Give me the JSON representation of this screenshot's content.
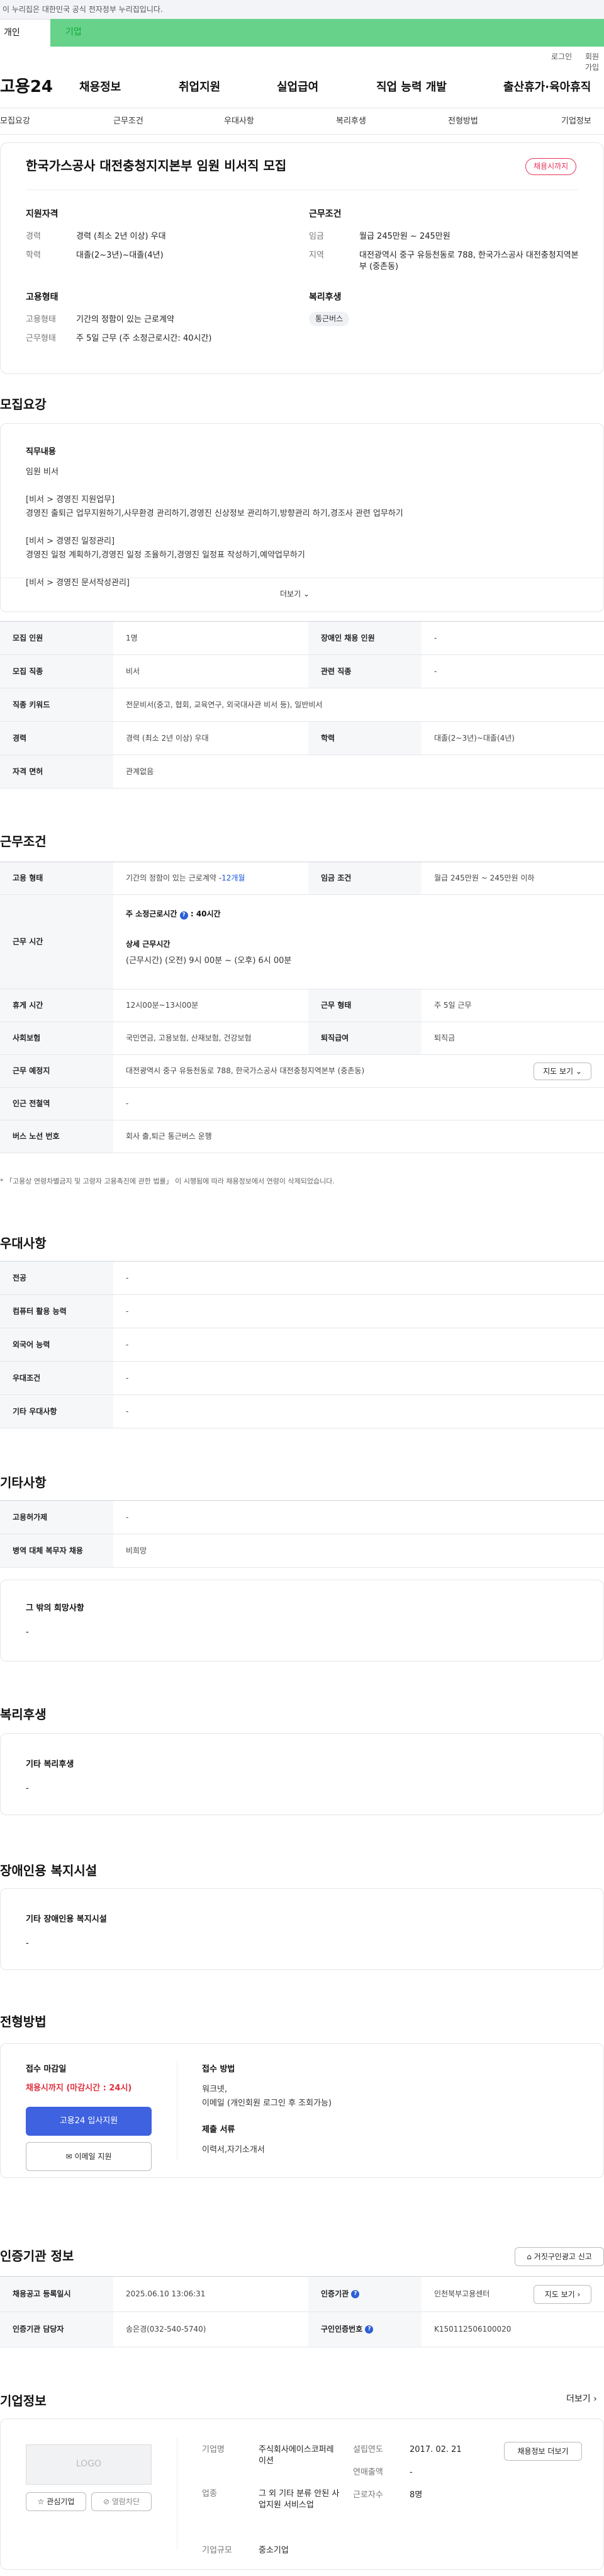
{
  "gov_banner": "이 누리집은 대한민국 공식 전자정부 누리집입니다.",
  "user_tabs": {
    "person": "개인",
    "company": "기업"
  },
  "util": {
    "login": "로그인",
    "join": "회원가입"
  },
  "gnb": {
    "logo": "고용24",
    "items": [
      "채용정보",
      "취업지원",
      "실업급여",
      "직업 능력 개발",
      "출산휴가·육아휴직"
    ]
  },
  "anchors": [
    "모집요강",
    "근무조건",
    "우대사항",
    "복리후생",
    "전형방법",
    "기업정보"
  ],
  "header": {
    "title": "한국가스공사 대전충청지지본부 임원 비서직 모집",
    "status": "채용시까지",
    "qual_title": "지원자격",
    "career_label": "경력",
    "career_value": "경력 (최소 2년 이상) 우대",
    "edu_label": "학력",
    "edu_value": "대졸(2~3년)~대졸(4년)",
    "cond_title": "근무조건",
    "wage_label": "임금",
    "wage_value": "월급 245만원 ~ 245만원",
    "region_label": "지역",
    "region_value": "대전광역시 중구 유등천동로 788, 한국가스공사 대전충청지역본부 (중촌동)",
    "emp_title": "고용형태",
    "emp_type_label": "고용형태",
    "emp_type_value": "기간의 정함이 있는 근로계약",
    "work_type_label": "근무형태",
    "work_type_value": "주 5일 근무 (주 소정근로시간: 40시간)",
    "welfare_title": "복리후생",
    "welfare_chip": "통근버스"
  },
  "recruit": {
    "title": "모집요강",
    "job_title": "직무내용",
    "lines": [
      "임원 비서",
      "",
      "[비서 > 경영진 지원업무]",
      "경영진 출퇴근 업무지원하기,사무환경 관리하기,경영진 신상정보 관리하기,방향관리 하기,경조사 관련 업무하기",
      "",
      "[비서 > 경영진 일정관리]",
      "경영진 일정 계획하기,경영진 일정 조율하기,경영진 일정표 작성하기,예약업무하기",
      "",
      "[비서 > 경영진 문서작성관리]"
    ],
    "more": "더보기",
    "table": [
      {
        "l1": "모집 인원",
        "v1": "1명",
        "l2": "장애인 채용 인원",
        "v2": "-"
      },
      {
        "l1": "모집 직종",
        "v1": "비서",
        "l2": "관련 직종",
        "v2": "-"
      },
      {
        "l1": "직종 키워드",
        "v1": "전문비서(중고, 협회, 교육연구, 외국대사관 비서 등), 일반비서",
        "l2": "",
        "v2": ""
      },
      {
        "l1": "경력",
        "v1": "경력 (최소 2년 이상) 우대",
        "l2": "학력",
        "v2": "대졸(2~3년)~대졸(4년)"
      },
      {
        "l1": "자격 면허",
        "v1": "관계없음",
        "l2": "",
        "v2": ""
      }
    ]
  },
  "work": {
    "title": "근무조건",
    "emp_label": "고용 형태",
    "emp_value": "기간의 정함이 있는 근로계약 - ",
    "emp_months": "12개월",
    "wage_label": "임금 조건",
    "wage_value": "월급 245만원 ~ 245만원 이하",
    "hours_label": "근무 시간",
    "hours_line1": "주 소정근로시간",
    "hours_value": "40시간",
    "detail_title": "상세 근무시간",
    "detail_value": "(근무시간) (오전) 9시 00분 ~ (오후) 6시 00분",
    "break_label": "휴게 시간",
    "break_value": "12시00분~13시00분",
    "form_label": "근무 형태",
    "form_value": "주 5일 근무",
    "ins_label": "사회보험",
    "ins_value": "국민연금, 고용보험, 산재보험, 건강보험",
    "ret_label": "퇴직급여",
    "ret_value": "퇴직금",
    "place_label": "근무 예정지",
    "place_value": "대전광역시 중구 유등천동로 788, 한국가스공사 대전충청지역본부 (중촌동)",
    "map_btn": "지도 보기",
    "station_label": "인근 전철역",
    "station_value": "-",
    "bus_label": "버스 노선 번호",
    "bus_value": "회사 출,퇴근 통근버스 운행",
    "note": "* 「고용상 연령차별금지 및 고령자 고용촉진에 관한 법률」 이 시행됨에 따라 채용정보에서 연령이 삭제되었습니다."
  },
  "pref": {
    "title": "우대사항",
    "rows": [
      [
        "전공",
        "-"
      ],
      [
        "컴퓨터 활용 능력",
        "-"
      ],
      [
        "외국어 능력",
        "-"
      ],
      [
        "우대조건",
        "-"
      ],
      [
        "기타 우대사항",
        "-"
      ]
    ]
  },
  "etc": {
    "title": "기타사항",
    "rows": [
      [
        "고용허가제",
        "-"
      ],
      [
        "병역 대체 복무자 채용",
        "비희망"
      ]
    ],
    "box_title": "그 밖의 희망사항",
    "box_value": "-"
  },
  "welfare": {
    "title": "복리후생",
    "box_title": "기타 복리후생",
    "box_value": "-"
  },
  "disab": {
    "title": "장애인용 복지시설",
    "box_title": "기타 장애인용 복지시설",
    "box_value": "-"
  },
  "apply": {
    "title": "전형방법",
    "deadline_label": "접수 마감일",
    "deadline_value": "채용시까지 (마감시간 : 24시)",
    "apply_btn": "고용24 입사지원",
    "email_btn": "이메일 지원",
    "method_label": "접수 방법",
    "method_lines": [
      "워크넷,",
      "이메일 (개인회원 로그인 후 조회가능)"
    ],
    "docs_label": "제출 서류",
    "docs_value": "이력서,자기소개서"
  },
  "auth": {
    "title": "인증기관 정보",
    "report_btn": "거짓구인광고 신고",
    "reg_label": "채용공고 등록일시",
    "reg_value": "2025.06.10 13:06:31",
    "org_label": "인증기관",
    "org_value": "인천북부고용센터",
    "map_btn": "지도 보기",
    "mgr_label": "인증기관 담당자",
    "mgr_value": "송은경(032-540-5740)",
    "id_label": "구인인증번호",
    "id_value": "K150112506100020"
  },
  "company": {
    "title": "기업정보",
    "more": "더보기",
    "logo_text": "LOGO",
    "fav": "관심기업",
    "view": "열람차단",
    "name_label": "기업명",
    "name_value": "주식회사에이스코퍼레이션",
    "ind_label": "업종",
    "ind_value": "그 외 기타 분류 안된 사업지원 서비스업",
    "scale_label": "기업규모",
    "scale_value": "중소기업",
    "est_label": "설립연도",
    "est_value": "2017. 02. 21",
    "sales_label": "연매출액",
    "sales_value": "-",
    "emp_label": "근로자수",
    "emp_value": "8명",
    "jobs_btn": "채용정보 더보기"
  }
}
